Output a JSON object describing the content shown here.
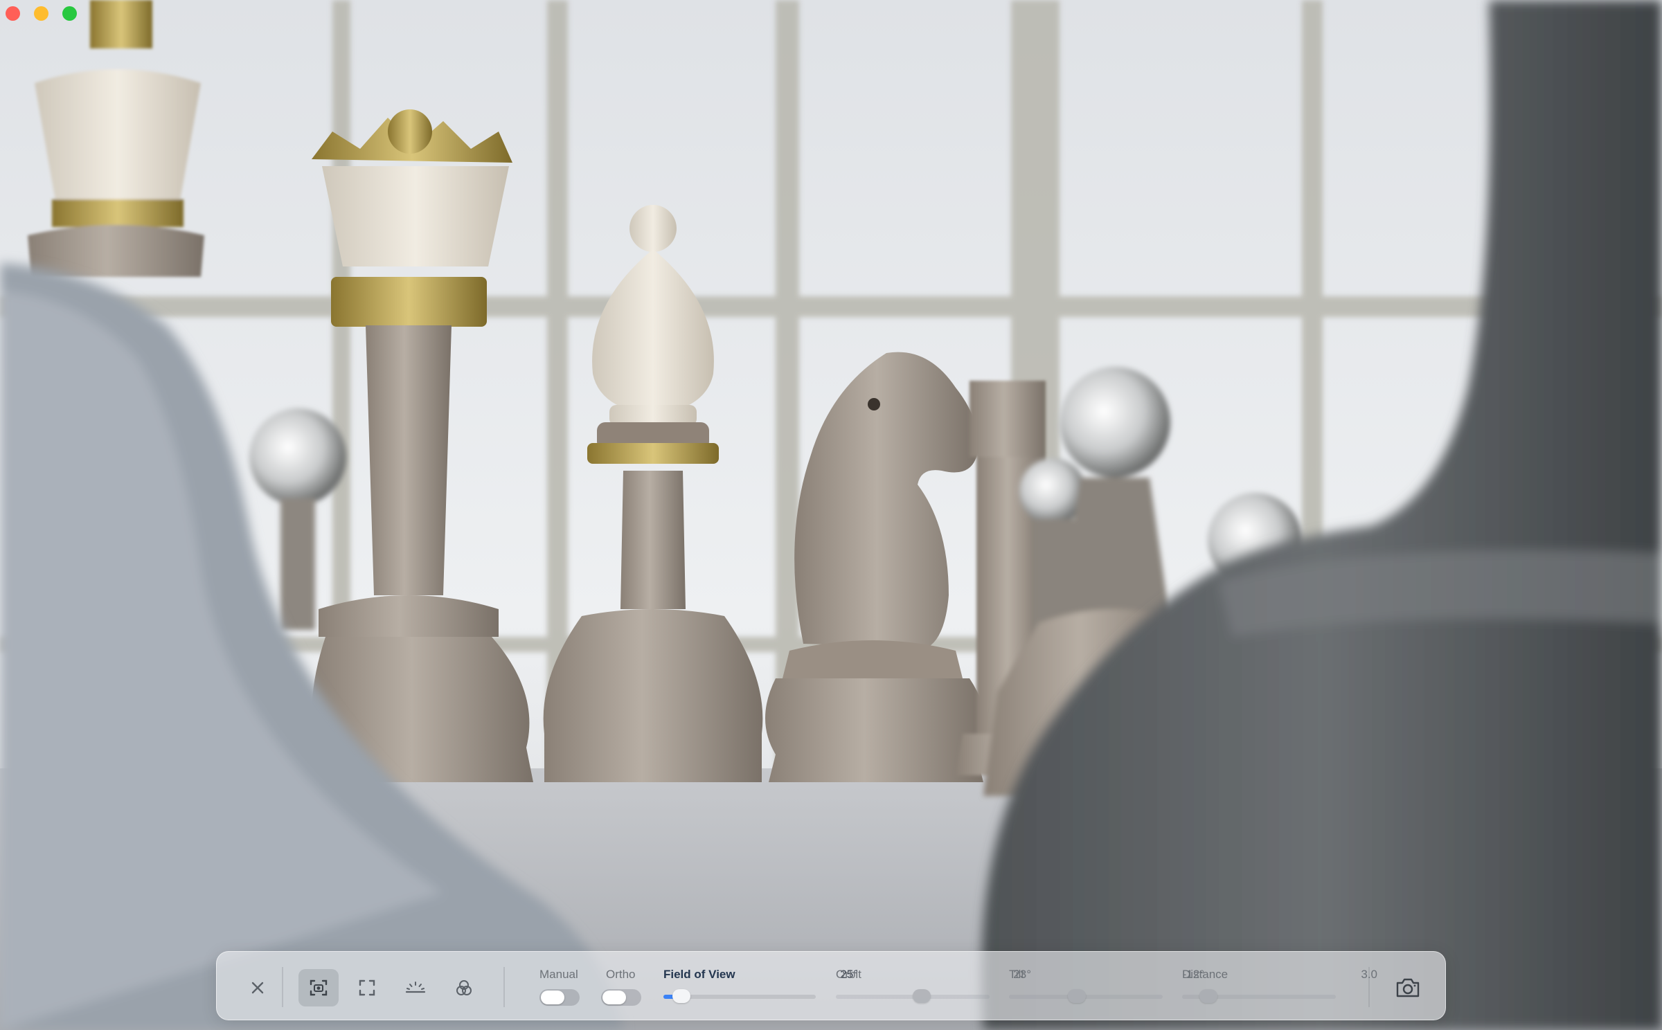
{
  "window": {
    "controls": [
      "close",
      "minimize",
      "maximize"
    ]
  },
  "scene": {
    "subject": "chess-pieces-3d-render"
  },
  "toolbar": {
    "close_icon": "close-icon",
    "buttons": [
      {
        "name": "camera-view-icon",
        "active": true
      },
      {
        "name": "fullscreen-icon",
        "active": false
      },
      {
        "name": "horizon-icon",
        "active": false
      },
      {
        "name": "lighting-icon",
        "active": false
      }
    ],
    "manual_label": "Manual",
    "ortho_label": "Ortho",
    "field_of_view": {
      "label": "Field of View",
      "value": "25°",
      "level": 0.12
    },
    "orbit": {
      "label": "Orbit",
      "value": "23°",
      "level": 0.56
    },
    "tilt": {
      "label": "Tilt",
      "value": "-12°",
      "level": 0.44
    },
    "distance": {
      "label": "Distance",
      "value": "3.0",
      "level": 0.17
    },
    "snapshot_icon": "snapshot-camera-icon",
    "accent_color": "#3b82f6"
  }
}
